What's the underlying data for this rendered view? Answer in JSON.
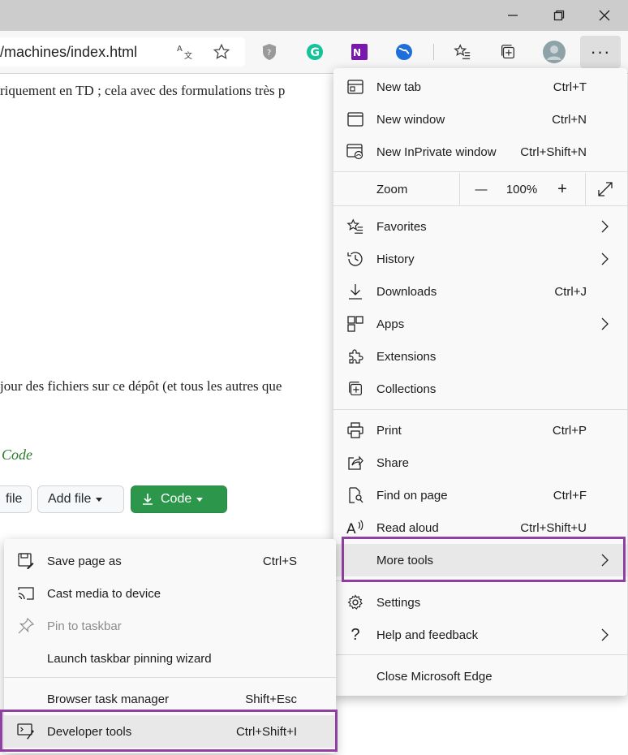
{
  "address": {
    "text": "/machines/index.html"
  },
  "page": {
    "line1": "riquement en TD ; cela avec des formulations très p",
    "line2": "jour des fichiers sur ce dépôt (et tous les autres que",
    "green": "Code",
    "btn_file": "file",
    "btn_add_file": "Add file",
    "btn_code": "Code"
  },
  "menu": {
    "items": [
      {
        "label": "New tab",
        "shortcut": "Ctrl+T"
      },
      {
        "label": "New window",
        "shortcut": "Ctrl+N"
      },
      {
        "label": "New InPrivate window",
        "shortcut": "Ctrl+Shift+N"
      },
      {
        "label": "Zoom"
      },
      {
        "label": "Favorites"
      },
      {
        "label": "History"
      },
      {
        "label": "Downloads",
        "shortcut": "Ctrl+J"
      },
      {
        "label": "Apps"
      },
      {
        "label": "Extensions"
      },
      {
        "label": "Collections"
      },
      {
        "label": "Print",
        "shortcut": "Ctrl+P"
      },
      {
        "label": "Share"
      },
      {
        "label": "Find on page",
        "shortcut": "Ctrl+F"
      },
      {
        "label": "Read aloud",
        "shortcut": "Ctrl+Shift+U"
      },
      {
        "label": "More tools"
      },
      {
        "label": "Settings"
      },
      {
        "label": "Help and feedback"
      },
      {
        "label": "Close Microsoft Edge"
      }
    ],
    "zoom_value": "100%",
    "zoom_minus": "—",
    "zoom_plus": "+"
  },
  "submenu": {
    "items": [
      {
        "label": "Save page as",
        "shortcut": "Ctrl+S"
      },
      {
        "label": "Cast media to device"
      },
      {
        "label": "Pin to taskbar",
        "disabled": true
      },
      {
        "label": "Launch taskbar pinning wizard"
      },
      {
        "label": "Browser task manager",
        "shortcut": "Shift+Esc"
      },
      {
        "label": "Developer tools",
        "shortcut": "Ctrl+Shift+I"
      }
    ]
  },
  "colors": {
    "highlight_box": "#9040a0",
    "code_button": "#2c974b"
  }
}
